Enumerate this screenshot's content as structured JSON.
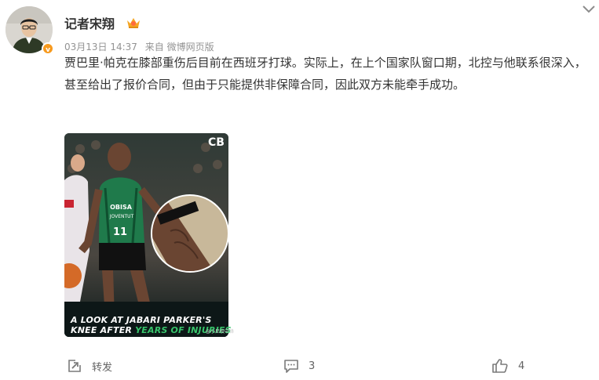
{
  "post": {
    "author": "记者宋翔",
    "date": "03月13日 14:37",
    "source": "来自 微博网页版",
    "text": "贾巴里·帕克在膝部重伤后目前在西班牙打球。实际上，在上个国家队窗口期，北控与他联系很深入，甚至给出了报价合同，但由于只能提供非保障合同，因此双方未能牵手成功。",
    "image": {
      "logo": "CB",
      "caption_line1": "A LOOK AT JABARI PARKER'S",
      "caption_line2_prefix": "KNEE AFTER ",
      "caption_line2_highlight": "YEARS OF INJURIES",
      "jersey_number": "11",
      "sponsor": "OBISA",
      "team": "JOVENTUT",
      "watermark": "@小尼校中锋"
    }
  },
  "actions": {
    "repost_label": "转发",
    "comment_count": "3",
    "like_count": "4"
  },
  "colors": {
    "text": "#333333",
    "meta": "#939393",
    "action": "#636363",
    "highlight_green": "#37c46b",
    "badge_orange": "#f79a1e"
  }
}
